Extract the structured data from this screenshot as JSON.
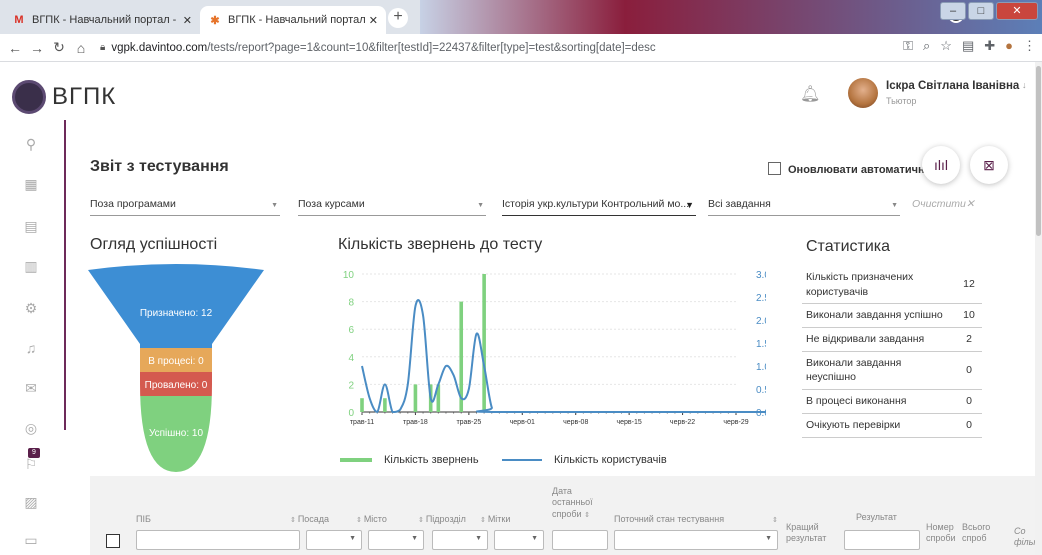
{
  "browser": {
    "tabs": [
      {
        "title": "ВГПК - Навчальний портал - На",
        "favicon": "gmail-icon"
      },
      {
        "title": "ВГПК - Навчальний портал",
        "favicon": "joomla-icon"
      }
    ],
    "url_host": "vgpk.davintoo.com",
    "url_path": "/tests/report?page=1&count=10&filter[testId]=22437&filter[type]=test&sorting[date]=desc"
  },
  "header": {
    "brand": "ВГПК",
    "user_name": "Іскра Світлана Іванівна",
    "user_role": "Тьютор"
  },
  "sidebar": {
    "badge": "9"
  },
  "page": {
    "title": "Звіт з тестування",
    "auto_refresh_label": "Оновлювати автоматично"
  },
  "filters": {
    "programs": "Поза програмами",
    "courses": "Поза курсами",
    "test": "Історія укр.культури Контрольний мо...",
    "tasks": "Всі завдання",
    "clear": "Очистити"
  },
  "funnel": {
    "title": "Огляд успішності",
    "assigned": "Призначено: 12",
    "in_progress": "В процесі: 0",
    "failed": "Провалено: 0",
    "success": "Успішно: 10"
  },
  "chart_data": {
    "type": "bar",
    "title": "Кількість звернень до тесту",
    "categories": [
      "трав-11",
      "трав-18",
      "трав-25",
      "черв-01",
      "черв-08",
      "черв-15",
      "черв-22",
      "черв-29"
    ],
    "y_left_ticks": [
      "0",
      "2",
      "4",
      "6",
      "8",
      "10"
    ],
    "y_right_ticks": [
      "0.0",
      "0.5",
      "1.0",
      "1.5",
      "2.0",
      "2.5",
      "3.0"
    ],
    "ylim_left": [
      0,
      10
    ],
    "ylim_right": [
      0,
      3
    ],
    "series": [
      {
        "name": "Кількість звернень",
        "type": "bar",
        "color": "#7fd17f",
        "x_days": [
          0,
          1,
          2,
          3,
          4,
          5,
          6,
          7,
          8,
          9,
          10,
          11,
          12,
          13,
          14,
          15,
          16
        ],
        "values": [
          1,
          0,
          0,
          1,
          0,
          0,
          0,
          2,
          0,
          2,
          2,
          0,
          0,
          8,
          0,
          0,
          10
        ]
      },
      {
        "name": "Кількість користувачів",
        "type": "line",
        "color": "#4a8cc4",
        "points": [
          [
            0,
            1.0
          ],
          [
            1,
            0.3
          ],
          [
            2,
            0.0
          ],
          [
            3,
            0.6
          ],
          [
            4,
            0.0
          ],
          [
            5,
            0.05
          ],
          [
            6,
            0.6
          ],
          [
            7,
            2.3
          ],
          [
            8,
            2.1
          ],
          [
            9,
            0.3
          ],
          [
            10,
            0.6
          ],
          [
            11,
            1.0
          ],
          [
            12,
            0.8
          ],
          [
            13,
            0.3
          ],
          [
            14,
            0.5
          ],
          [
            15,
            1.7
          ],
          [
            16,
            1.0
          ],
          [
            17,
            0.1
          ],
          [
            18,
            0
          ],
          [
            54,
            0
          ]
        ]
      }
    ],
    "legend": "bottom"
  },
  "stats": {
    "title": "Статистика",
    "rows": [
      {
        "label": "Кількість призначених користувачів",
        "value": "12"
      },
      {
        "label": "Виконали завдання успішно",
        "value": "10"
      },
      {
        "label": "Не відкривали завдання",
        "value": "2"
      },
      {
        "label": "Виконали завдання неуспішно",
        "value": "0"
      },
      {
        "label": "В процесі виконання",
        "value": "0"
      },
      {
        "label": "Очікують перевірки",
        "value": "0"
      }
    ]
  },
  "table": {
    "headers": {
      "name": "ПІБ",
      "position": "Посада",
      "city": "Місто",
      "division": "Підрозділ",
      "tags": "Мітки",
      "last_attempt": "Дата останньої спроби",
      "state": "Поточний стан тестування",
      "best": "Кращий результат",
      "result": "Результат",
      "attempt_no": "Номер спроби",
      "total": "Всього спроб",
      "filter": "Со фільт"
    }
  }
}
